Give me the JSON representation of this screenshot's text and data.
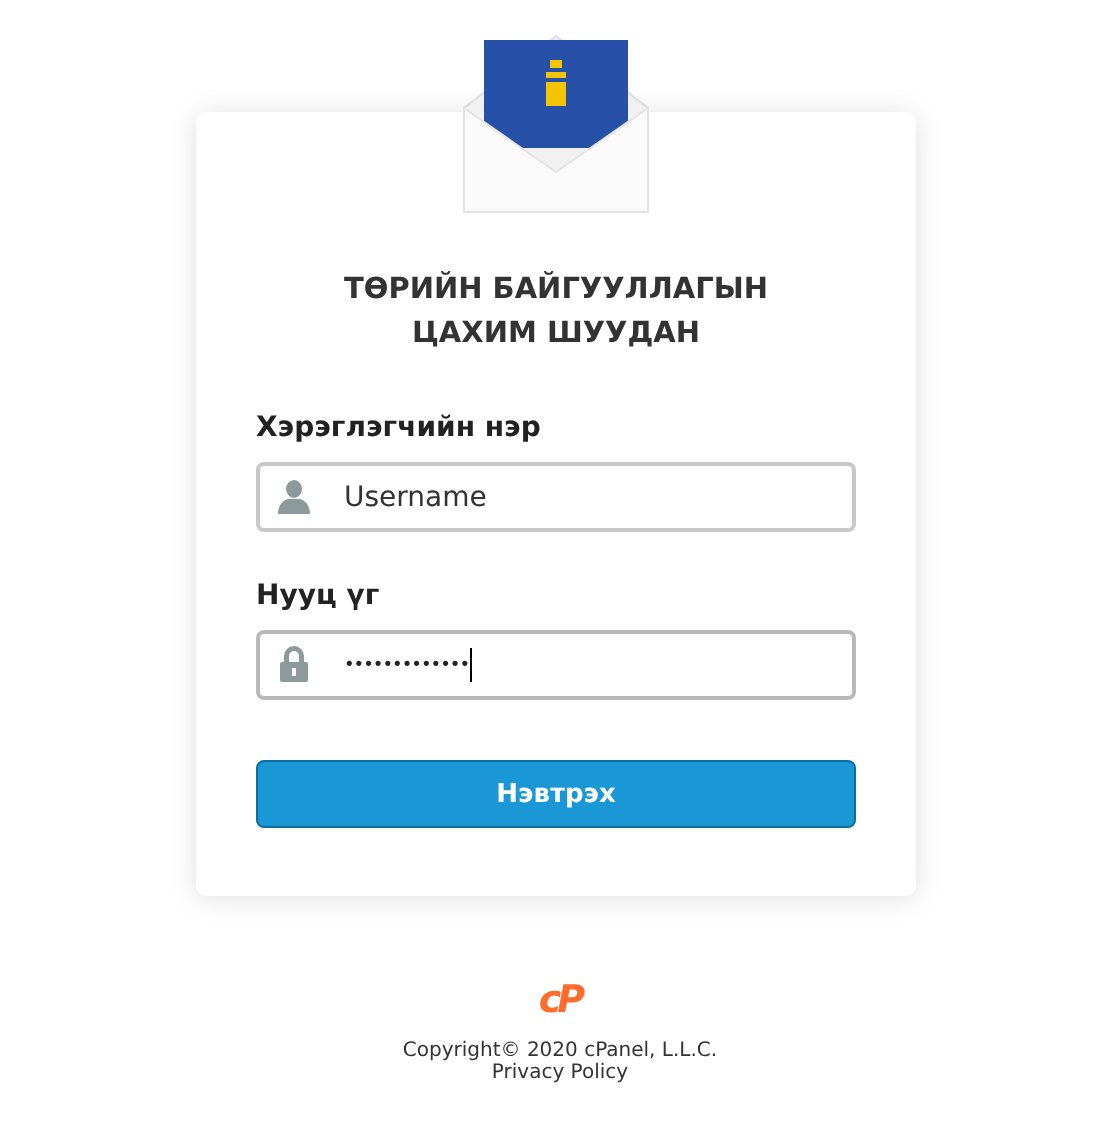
{
  "title_lines": [
    "ТӨРИЙН БАЙГУУЛЛАГЫН",
    "ЦАХИМ ШУУДАН"
  ],
  "fields": [
    {
      "label": "Хэрэглэгчийн нэр",
      "kind": "user",
      "placeholder": "Username",
      "focused": false
    },
    {
      "label": "Нууц үг",
      "kind": "password",
      "value": "•••••••••••••",
      "focused": true
    }
  ],
  "button": "Нэвтрэх",
  "footer": {
    "logo": "cP",
    "copyright": "Copyright© 2020 cPanel, L.L.C.",
    "link": "Privacy Policy"
  }
}
